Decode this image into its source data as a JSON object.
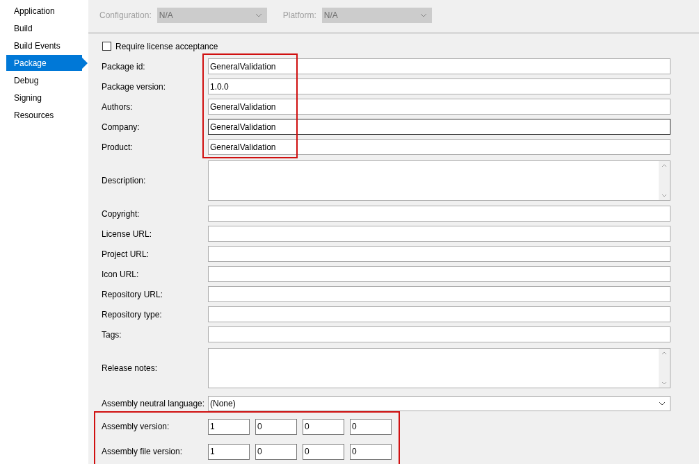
{
  "sidebar": {
    "items": [
      {
        "label": "Application",
        "selected": false
      },
      {
        "label": "Build",
        "selected": false
      },
      {
        "label": "Build Events",
        "selected": false
      },
      {
        "label": "Package",
        "selected": true
      },
      {
        "label": "Debug",
        "selected": false
      },
      {
        "label": "Signing",
        "selected": false
      },
      {
        "label": "Resources",
        "selected": false
      }
    ]
  },
  "toolbar": {
    "configuration": {
      "label": "Configuration:",
      "value": "N/A",
      "disabled": true
    },
    "platform": {
      "label": "Platform:",
      "value": "N/A",
      "disabled": true
    }
  },
  "require_license_acceptance": {
    "label": "Require license acceptance",
    "checked": false
  },
  "sections": [
    {
      "highlighted": true,
      "rows": [
        {
          "kind": "text",
          "label": "Package id:",
          "value": "GeneralValidation",
          "focused": false
        },
        {
          "kind": "text",
          "label": "Package version:",
          "value": "1.0.0",
          "focused": false
        },
        {
          "kind": "text",
          "label": "Authors:",
          "value": "GeneralValidation",
          "focused": false
        },
        {
          "kind": "text",
          "label": "Company:",
          "value": "GeneralValidation",
          "focused": true
        },
        {
          "kind": "text",
          "label": "Product:",
          "value": "GeneralValidation",
          "focused": false
        }
      ]
    },
    {
      "highlighted": false,
      "rows": [
        {
          "kind": "multiline",
          "label": "Description:"
        },
        {
          "kind": "text",
          "label": "Copyright:",
          "focused": false
        },
        {
          "kind": "text",
          "label": "License URL:",
          "focused": false
        },
        {
          "kind": "text",
          "label": "Project URL:",
          "focused": false
        },
        {
          "kind": "text",
          "label": "Icon URL:",
          "focused": false
        },
        {
          "kind": "text",
          "label": "Repository URL:",
          "focused": false
        },
        {
          "kind": "text",
          "label": "Repository type:",
          "focused": false
        },
        {
          "kind": "text",
          "label": "Tags:",
          "focused": false
        },
        {
          "kind": "multiline",
          "label": "Release notes:"
        },
        {
          "kind": "dropdown",
          "label": "Assembly neutral language:",
          "value": "(None)"
        }
      ]
    },
    {
      "highlighted": true,
      "rows": [
        {
          "kind": "version",
          "label": "Assembly version:",
          "parts": [
            "1",
            "0",
            "0",
            "0"
          ]
        },
        {
          "kind": "version",
          "label": "Assembly file version:",
          "parts": [
            "1",
            "0",
            "0",
            "0"
          ]
        }
      ]
    }
  ]
}
